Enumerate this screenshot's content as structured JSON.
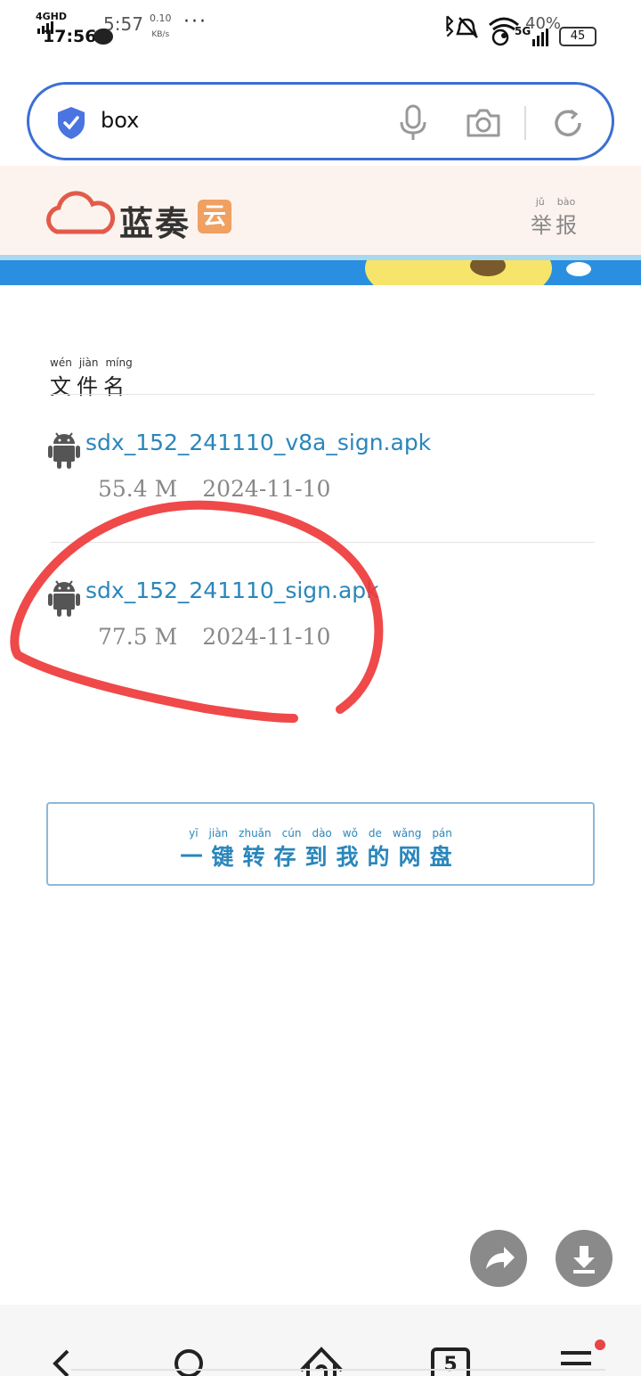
{
  "status_bar": {
    "network": "4GHD",
    "time_primary": "5:57",
    "time_secondary": "17:56",
    "speed_value": "0.10",
    "speed_unit": "KB/s",
    "more": "···",
    "battery_percent": "40%",
    "network_right": "5G",
    "battery_level": "45"
  },
  "search": {
    "query": "box"
  },
  "site": {
    "logo_text": "蓝奏",
    "logo_badge": "云",
    "report_pinyin": [
      "jǔ",
      "bào"
    ],
    "report_text": "举报"
  },
  "list": {
    "header_pinyin": [
      "wén",
      "jiàn",
      "míng"
    ],
    "header_text": "文件名",
    "files": [
      {
        "name": "sdx_152_241110_v8a_sign.apk",
        "size": "55.4 M",
        "date": "2024-11-10"
      },
      {
        "name": "sdx_152_241110_sign.apk",
        "size": "77.5 M",
        "date": "2024-11-10"
      }
    ]
  },
  "save_button": {
    "pinyin": [
      "yī",
      "jiàn",
      "zhuǎn",
      "cún",
      "dào",
      "wǒ",
      "de",
      "wǎng",
      "pán"
    ],
    "label": "一键转存到我的网盘"
  },
  "bottom_nav": {
    "tab_count": "5"
  },
  "colors": {
    "accent_blue": "#3b6fd4",
    "link": "#2a86bb",
    "annotation_red": "#ee3a3a"
  },
  "icons": [
    "shield-check-icon",
    "microphone-icon",
    "camera-icon",
    "reload-icon",
    "android-icon",
    "share-icon",
    "download-icon",
    "back-icon",
    "search-icon",
    "home-icon",
    "tabs-icon",
    "menu-icon"
  ]
}
